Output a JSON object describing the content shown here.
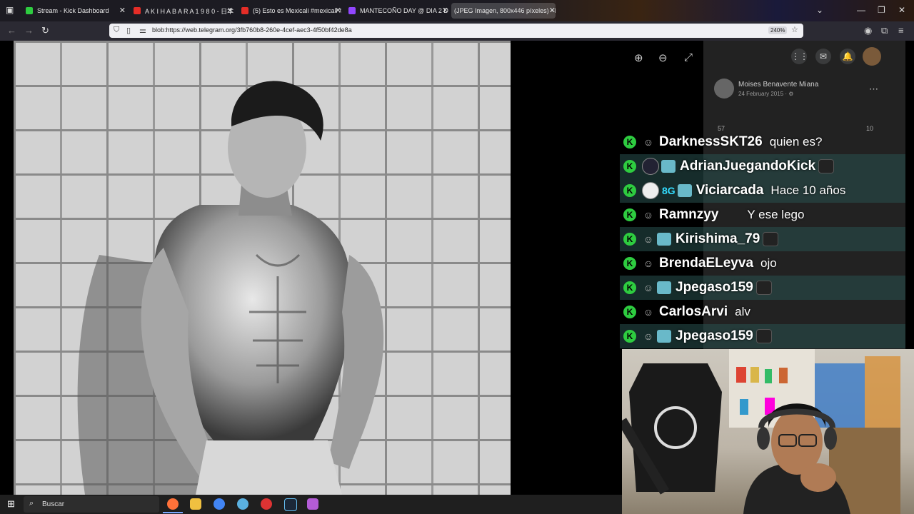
{
  "tabs": [
    {
      "label": "Stream - Kick Dashboard",
      "close": "✕"
    },
    {
      "label": "A K I H A B A R A  1 9 8 0 - 日本",
      "close": "✕"
    },
    {
      "label": "(5) Esto es Mexicali #mexicali #",
      "close": "✕"
    },
    {
      "label": "MANTECOÑO DAY @ DIA 2 DI",
      "close": "✕"
    },
    {
      "label": "(JPEG Imagen, 800x446 píxeles) - E",
      "close": "✕"
    }
  ],
  "window_controls": {
    "dropdown": "⌄",
    "minimize": "—",
    "maximize": "❐",
    "close": "✕"
  },
  "address": {
    "url": "blob:https://web.telegram.org/3fb760b8-260e-4cef-aec3-4f50bf42de8a",
    "zoom": "240%"
  },
  "facebook": {
    "author": "Moises Benavente Miana",
    "date": "24 February 2015 · ⚙",
    "reactions_left": "57",
    "reactions_right": "10"
  },
  "chat": [
    {
      "name": "DarknessSKT26",
      "message": "quien es?",
      "avatar": false
    },
    {
      "name": "AdrianJuegandoKick",
      "message": "",
      "avatar": true
    },
    {
      "name": "Viciarcada",
      "message": "Hace 10 años",
      "avatar": true,
      "badge": "8G"
    },
    {
      "name": "Ramnzyy",
      "message": "Y ese lego",
      "avatar": false
    },
    {
      "name": "Kirishima_79",
      "message": "",
      "avatar": false
    },
    {
      "name": "BrendaELeyva",
      "message": "ojo",
      "avatar": false
    },
    {
      "name": "Jpegaso159",
      "message": "",
      "avatar": false
    },
    {
      "name": "CarlosArvi",
      "message": "alv",
      "avatar": false
    },
    {
      "name": "Jpegaso159",
      "message": "",
      "avatar": false
    }
  ],
  "taskbar": {
    "search_placeholder": "Buscar"
  },
  "colors": {
    "kick_green": "#2ecc40",
    "chat_alt_row": "#28504e"
  }
}
